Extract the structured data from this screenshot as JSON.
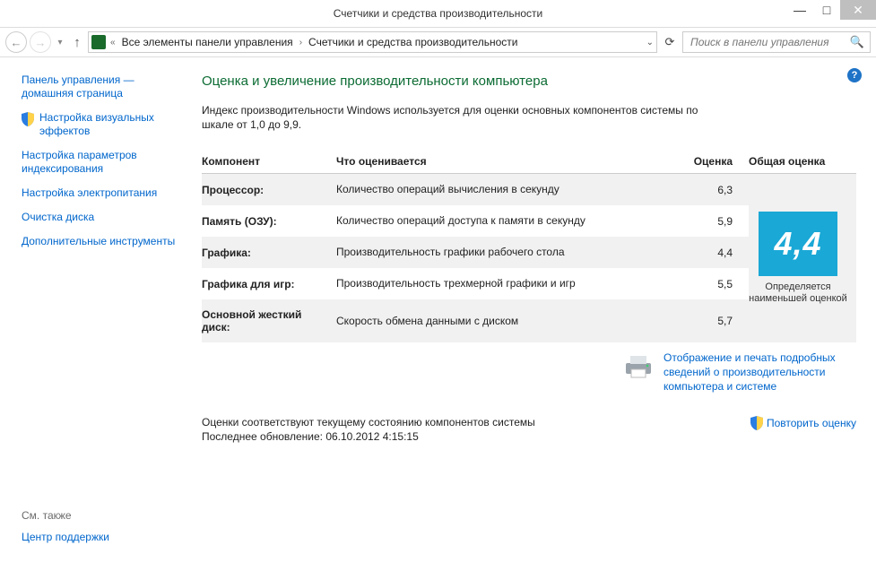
{
  "window": {
    "title": "Счетчики и средства производительности"
  },
  "breadcrumb": {
    "prefix": "«",
    "seg1": "Все элементы панели управления",
    "seg2": "Счетчики и средства производительности"
  },
  "search": {
    "placeholder": "Поиск в панели управления"
  },
  "sidebar": {
    "home1": "Панель управления —",
    "home2": "домашняя страница",
    "items": [
      "Настройка визуальных эффектов",
      "Настройка параметров индексирования",
      "Настройка электропитания",
      "Очистка диска",
      "Дополнительные инструменты"
    ],
    "see_also_header": "См. также",
    "see_also_link": "Центр поддержки"
  },
  "main": {
    "title": "Оценка и увеличение производительности компьютера",
    "intro": "Индекс производительности Windows используется для оценки основных компонентов системы по шкале от 1,0 до 9,9.",
    "headers": {
      "component": "Компонент",
      "what": "Что оценивается",
      "score": "Оценка",
      "overall": "Общая оценка"
    },
    "rows": [
      {
        "comp": "Процессор:",
        "desc": "Количество операций вычисления в секунду",
        "score": "6,3",
        "band": true
      },
      {
        "comp": "Память (ОЗУ):",
        "desc": "Количество операций доступа к памяти в секунду",
        "score": "5,9",
        "band": false
      },
      {
        "comp": "Графика:",
        "desc": "Производительность графики рабочего стола",
        "score": "4,4",
        "band": true
      },
      {
        "comp": "Графика для игр:",
        "desc": "Производительность трехмерной графики и игр",
        "score": "5,5",
        "band": false
      },
      {
        "comp": "Основной жесткий диск:",
        "desc": "Скорость обмена данными с диском",
        "score": "5,7",
        "band": true
      }
    ],
    "overall": {
      "value": "4,4",
      "caption": "Определяется наименьшей оценкой"
    },
    "print_link": "Отображение и печать подробных сведений о производительности компьютера и системе",
    "status_line1": "Оценки соответствуют текущему состоянию компонентов системы",
    "status_line2": "Последнее обновление: 06.10.2012 4:15:15",
    "rerun_label": "Повторить оценку"
  }
}
